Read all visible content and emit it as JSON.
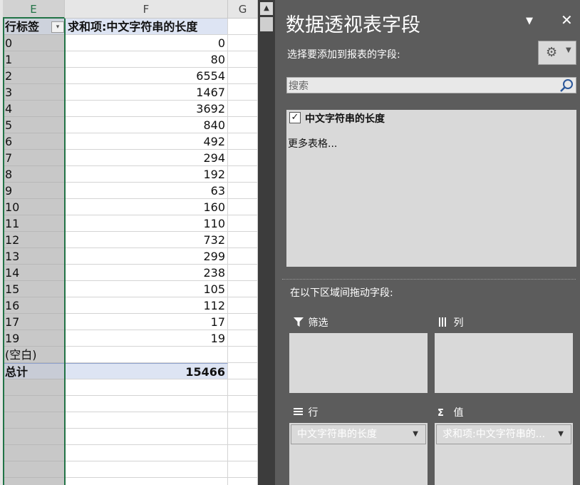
{
  "sheet": {
    "col_e": "E",
    "col_f": "F",
    "col_g": "G",
    "header_row_label": "行标签",
    "header_value_label": "求和项:中文字符串的长度",
    "filter_glyph": "▾",
    "rows": [
      {
        "label": "0",
        "value": "0"
      },
      {
        "label": "1",
        "value": "80"
      },
      {
        "label": "2",
        "value": "6554"
      },
      {
        "label": "3",
        "value": "1467"
      },
      {
        "label": "4",
        "value": "3692"
      },
      {
        "label": "5",
        "value": "840"
      },
      {
        "label": "6",
        "value": "492"
      },
      {
        "label": "7",
        "value": "294"
      },
      {
        "label": "8",
        "value": "192"
      },
      {
        "label": "9",
        "value": "63"
      },
      {
        "label": "10",
        "value": "160"
      },
      {
        "label": "11",
        "value": "110"
      },
      {
        "label": "12",
        "value": "732"
      },
      {
        "label": "13",
        "value": "299"
      },
      {
        "label": "14",
        "value": "238"
      },
      {
        "label": "15",
        "value": "105"
      },
      {
        "label": "16",
        "value": "112"
      },
      {
        "label": "17",
        "value": "17"
      },
      {
        "label": "19",
        "value": "19"
      },
      {
        "label": "(空白)",
        "value": ""
      }
    ],
    "total_label": "总计",
    "total_value": "15466"
  },
  "pane": {
    "title": "数据透视表字段",
    "dropdown_glyph": "▼",
    "close_glyph": "✕",
    "choose_fields_label": "选择要添加到报表的字段:",
    "gear_glyph": "⚙",
    "gear_caret": "▼",
    "search_placeholder": "搜索",
    "field_checked_glyph": "✓",
    "field_name": "中文字符串的长度",
    "more_tables": "更多表格...",
    "drag_label": "在以下区域间拖动字段:",
    "filters_label": "筛选",
    "columns_label": "列",
    "rows_label": "行",
    "values_label": "值",
    "filters_icon": "filter-icon",
    "columns_icon": "columns-icon",
    "rows_icon": "rows-icon",
    "values_icon": "sigma-icon",
    "rows_field": "中文字符串的长度",
    "values_field": "求和项:中文字符串的...",
    "pill_caret": "▼"
  },
  "colors": {
    "accent_green": "#217346",
    "pane_bg": "#5c5c5c",
    "pivot_header_bg": "#dde4f3"
  }
}
